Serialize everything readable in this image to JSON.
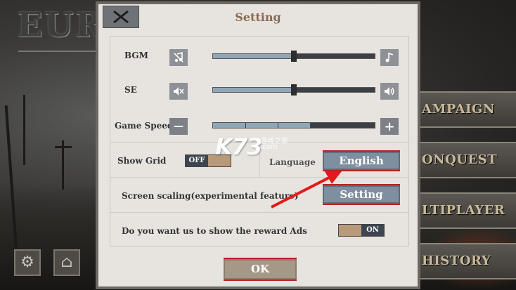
{
  "background": {
    "game_title_partial": "EUR",
    "menu_items": [
      "AMPAIGN",
      "ONQUEST",
      "LTIPLAYER",
      "HISTORY"
    ],
    "settings_icon": "gear-icon",
    "home_icon": "home-icon"
  },
  "dialog": {
    "title": "Setting",
    "close_icon": "close-icon",
    "bgm": {
      "label": "BGM",
      "icon_left": "music-off-icon",
      "icon_right": "music-note-icon",
      "value": 0.5
    },
    "se": {
      "label": "SE",
      "icon_left": "volume-mute-icon",
      "icon_right": "volume-up-icon",
      "value": 0.5
    },
    "game_speed": {
      "label": "Game Speed",
      "minus": "—",
      "plus": "+",
      "value": 0.6
    },
    "show_grid": {
      "label": "Show Grid",
      "state": "OFF"
    },
    "language": {
      "label": "Language",
      "value": "English"
    },
    "screen_scaling": {
      "label": "Screen scaling(experimental feature)",
      "button": "Setting"
    },
    "reward_ads": {
      "label": "Do you want us to show the reward Ads",
      "state": "ON"
    },
    "ok_label": "OK"
  },
  "watermark": {
    "big": "K73",
    "line1": "游戏之家",
    "line2": ".com"
  },
  "colors": {
    "accent_red": "#b52424",
    "title_brown": "#8a6a52",
    "button_blue": "#7e8fa0",
    "slider_blue": "#8fa6b8"
  }
}
